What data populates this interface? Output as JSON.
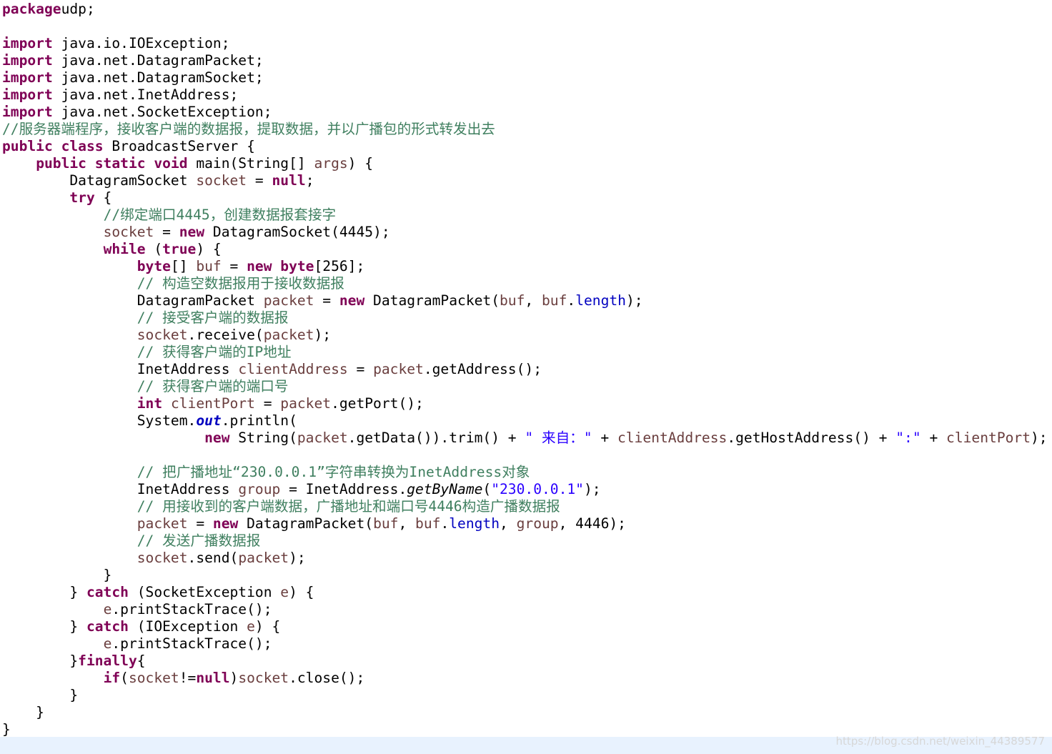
{
  "code_lines": [
    [
      [
        "kw",
        "package"
      ],
      [
        "",
        "udp;"
      ]
    ],
    [],
    [
      [
        "kw",
        "import"
      ],
      [
        "",
        " java.io.IOException;"
      ]
    ],
    [
      [
        "kw",
        "import"
      ],
      [
        "",
        " java.net.DatagramPacket;"
      ]
    ],
    [
      [
        "kw",
        "import"
      ],
      [
        "",
        " java.net.DatagramSocket;"
      ]
    ],
    [
      [
        "kw",
        "import"
      ],
      [
        "",
        " java.net.InetAddress;"
      ]
    ],
    [
      [
        "kw",
        "import"
      ],
      [
        "",
        " java.net.SocketException;"
      ]
    ],
    [
      [
        "cm",
        "//服务器端程序，接收客户端的数据报，提取数据，并以广播包的形式转发出去"
      ]
    ],
    [
      [
        "kw",
        "public"
      ],
      [
        "",
        " "
      ],
      [
        "kw",
        "class"
      ],
      [
        "",
        " BroadcastServer {"
      ]
    ],
    [
      [
        "",
        "    "
      ],
      [
        "kw",
        "public"
      ],
      [
        "",
        " "
      ],
      [
        "kw",
        "static"
      ],
      [
        "",
        " "
      ],
      [
        "kw",
        "void"
      ],
      [
        "",
        " main(String[] "
      ],
      [
        "vr",
        "args"
      ],
      [
        "",
        ") {"
      ]
    ],
    [
      [
        "",
        "        DatagramSocket "
      ],
      [
        "vr",
        "socket"
      ],
      [
        "",
        " = "
      ],
      [
        "kw",
        "null"
      ],
      [
        "",
        ";"
      ]
    ],
    [
      [
        "",
        "        "
      ],
      [
        "kw",
        "try"
      ],
      [
        "",
        " {"
      ]
    ],
    [
      [
        "",
        "            "
      ],
      [
        "cm",
        "//绑定端口4445，创建数据报套接字"
      ]
    ],
    [
      [
        "",
        "            "
      ],
      [
        "vr",
        "socket"
      ],
      [
        "",
        " = "
      ],
      [
        "kw",
        "new"
      ],
      [
        "",
        " DatagramSocket(4445);"
      ]
    ],
    [
      [
        "",
        "            "
      ],
      [
        "kw",
        "while"
      ],
      [
        "",
        " ("
      ],
      [
        "kw",
        "true"
      ],
      [
        "",
        ") {"
      ]
    ],
    [
      [
        "",
        "                "
      ],
      [
        "kw",
        "byte"
      ],
      [
        "",
        "[] "
      ],
      [
        "vr",
        "buf"
      ],
      [
        "",
        " = "
      ],
      [
        "kw",
        "new"
      ],
      [
        "",
        " "
      ],
      [
        "kw",
        "byte"
      ],
      [
        "",
        "[256];"
      ]
    ],
    [
      [
        "",
        "                "
      ],
      [
        "cm",
        "// 构造空数据报用于接收数据报"
      ]
    ],
    [
      [
        "",
        "                DatagramPacket "
      ],
      [
        "vr",
        "packet"
      ],
      [
        "",
        " = "
      ],
      [
        "kw",
        "new"
      ],
      [
        "",
        " DatagramPacket("
      ],
      [
        "vr",
        "buf"
      ],
      [
        "",
        ", "
      ],
      [
        "vr",
        "buf"
      ],
      [
        "",
        "."
      ],
      [
        "fd",
        "length"
      ],
      [
        "",
        ");"
      ]
    ],
    [
      [
        "",
        "                "
      ],
      [
        "cm",
        "// 接受客户端的数据报"
      ]
    ],
    [
      [
        "",
        "                "
      ],
      [
        "vr",
        "socket"
      ],
      [
        "",
        ".receive("
      ],
      [
        "vr",
        "packet"
      ],
      [
        "",
        ");"
      ]
    ],
    [
      [
        "",
        "                "
      ],
      [
        "cm",
        "// 获得客户端的IP地址"
      ]
    ],
    [
      [
        "",
        "                InetAddress "
      ],
      [
        "vr",
        "clientAddress"
      ],
      [
        "",
        " = "
      ],
      [
        "vr",
        "packet"
      ],
      [
        "",
        ".getAddress();"
      ]
    ],
    [
      [
        "",
        "                "
      ],
      [
        "cm",
        "// 获得客户端的端口号"
      ]
    ],
    [
      [
        "",
        "                "
      ],
      [
        "kw",
        "int"
      ],
      [
        "",
        " "
      ],
      [
        "vr",
        "clientPort"
      ],
      [
        "",
        " = "
      ],
      [
        "vr",
        "packet"
      ],
      [
        "",
        ".getPort();"
      ]
    ],
    [
      [
        "",
        "                System."
      ],
      [
        "sf",
        "out"
      ],
      [
        "",
        ".println("
      ]
    ],
    [
      [
        "",
        "                        "
      ],
      [
        "kw",
        "new"
      ],
      [
        "",
        " String("
      ],
      [
        "vr",
        "packet"
      ],
      [
        "",
        ".getData()).trim() + "
      ],
      [
        "st",
        "\" 来自：\""
      ],
      [
        "",
        " + "
      ],
      [
        "vr",
        "clientAddress"
      ],
      [
        "",
        ".getHostAddress() + "
      ],
      [
        "st",
        "\":\""
      ],
      [
        "",
        " + "
      ],
      [
        "vr",
        "clientPort"
      ],
      [
        "",
        ");"
      ]
    ],
    [],
    [
      [
        "",
        "                "
      ],
      [
        "cm",
        "// 把广播地址“230.0.0.1”字符串转换为InetAddress对象"
      ]
    ],
    [
      [
        "",
        "                InetAddress "
      ],
      [
        "vr",
        "group"
      ],
      [
        "",
        " = InetAddress."
      ],
      [
        "sm",
        "getByName"
      ],
      [
        "",
        "("
      ],
      [
        "st",
        "\"230.0.0.1\""
      ],
      [
        "",
        ");"
      ]
    ],
    [
      [
        "",
        "                "
      ],
      [
        "cm",
        "// 用接收到的客户端数据，广播地址和端口号4446构造广播数据报"
      ]
    ],
    [
      [
        "",
        "                "
      ],
      [
        "vr",
        "packet"
      ],
      [
        "",
        " = "
      ],
      [
        "kw",
        "new"
      ],
      [
        "",
        " DatagramPacket("
      ],
      [
        "vr",
        "buf"
      ],
      [
        "",
        ", "
      ],
      [
        "vr",
        "buf"
      ],
      [
        "",
        "."
      ],
      [
        "fd",
        "length"
      ],
      [
        "",
        ", "
      ],
      [
        "vr",
        "group"
      ],
      [
        "",
        ", 4446);"
      ]
    ],
    [
      [
        "",
        "                "
      ],
      [
        "cm",
        "// 发送广播数据报"
      ]
    ],
    [
      [
        "",
        "                "
      ],
      [
        "vr",
        "socket"
      ],
      [
        "",
        ".send("
      ],
      [
        "vr",
        "packet"
      ],
      [
        "",
        ");"
      ]
    ],
    [
      [
        "",
        "            }"
      ]
    ],
    [
      [
        "",
        "        } "
      ],
      [
        "kw",
        "catch"
      ],
      [
        "",
        " (SocketException "
      ],
      [
        "vr",
        "e"
      ],
      [
        "",
        ") {"
      ]
    ],
    [
      [
        "",
        "            "
      ],
      [
        "vr",
        "e"
      ],
      [
        "",
        ".printStackTrace();"
      ]
    ],
    [
      [
        "",
        "        } "
      ],
      [
        "kw",
        "catch"
      ],
      [
        "",
        " (IOException "
      ],
      [
        "vr",
        "e"
      ],
      [
        "",
        ") {"
      ]
    ],
    [
      [
        "",
        "            "
      ],
      [
        "vr",
        "e"
      ],
      [
        "",
        ".printStackTrace();"
      ]
    ],
    [
      [
        "",
        "        }"
      ],
      [
        "kw",
        "finally"
      ],
      [
        "",
        "{"
      ]
    ],
    [
      [
        "",
        "            "
      ],
      [
        "kw",
        "if"
      ],
      [
        "",
        "("
      ],
      [
        "vr",
        "socket"
      ],
      [
        "",
        "!="
      ],
      [
        "kw",
        "null"
      ],
      [
        "",
        ")"
      ],
      [
        "vr",
        "socket"
      ],
      [
        "",
        ".close();"
      ]
    ],
    [
      [
        "",
        "        }"
      ]
    ],
    [
      [
        "",
        "    }"
      ]
    ],
    [
      [
        "",
        "}"
      ]
    ]
  ],
  "watermark": "https://blog.csdn.net/weixin_44389577"
}
